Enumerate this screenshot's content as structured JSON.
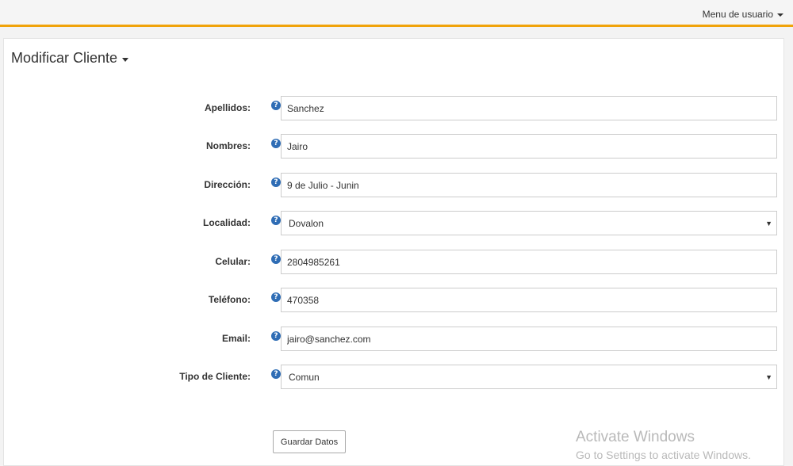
{
  "topbar": {
    "user_menu_label": "Menu de usuario"
  },
  "panel": {
    "title": "Modificar Cliente"
  },
  "form": {
    "apellidos": {
      "label": "Apellidos:",
      "value": "Sanchez"
    },
    "nombres": {
      "label": "Nombres:",
      "value": "Jairo"
    },
    "direccion": {
      "label": "Dirección:",
      "value": "9 de Julio - Junin"
    },
    "localidad": {
      "label": "Localidad:",
      "value": "Dovalon"
    },
    "celular": {
      "label": "Celular:",
      "value": "2804985261"
    },
    "telefono": {
      "label": "Teléfono:",
      "value": "470358"
    },
    "email": {
      "label": "Email:",
      "value": "jairo@sanchez.com"
    },
    "tipo_cliente": {
      "label": "Tipo de Cliente:",
      "value": "Comun"
    },
    "help_glyph": "?",
    "select_arrow": "▼",
    "save_label": "Guardar Datos"
  },
  "watermark": {
    "title": "Activate Windows",
    "subtitle": "Go to Settings to activate Windows."
  },
  "colors": {
    "accent": "#f0a30a",
    "help_icon": "#2f6db5"
  },
  "icons": {
    "help": "question-circle-icon",
    "caret": "caret-down-icon"
  }
}
